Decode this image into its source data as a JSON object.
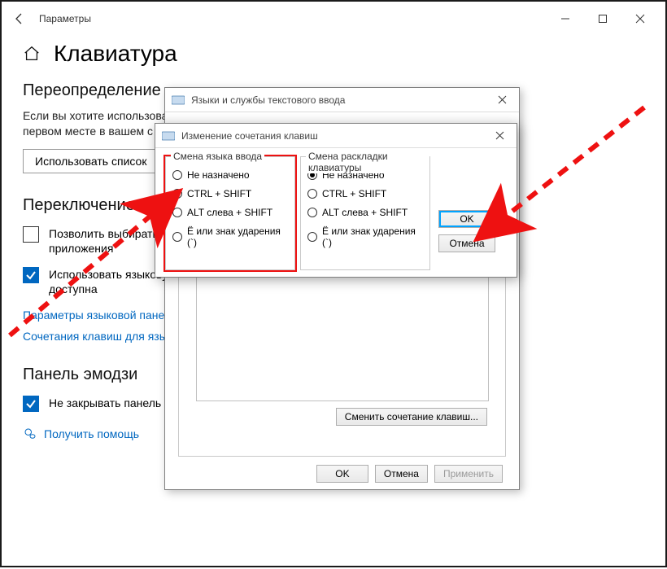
{
  "window": {
    "title": "Параметры",
    "page_title": "Клавиатура"
  },
  "sections": {
    "override": {
      "heading": "Переопределение",
      "text": "Если вы хотите использовать\nпервом месте в вашем с",
      "button": "Использовать список"
    },
    "switching": {
      "heading": "Переключение м",
      "chk1": "Позволить выбирать м\nприложения",
      "chk2": "Использовать языкову\nдоступна",
      "link1": "Параметры языковой пане",
      "link2": "Сочетания клавиш для язы"
    },
    "emoji": {
      "heading": "Панель эмодзи",
      "chk": "Не закрывать панель автоматически после ввода эмодзи"
    },
    "help_link": "Получить помощь"
  },
  "dialog_mid": {
    "title": "Языки и службы текстового ввода",
    "change_btn": "Сменить сочетание клавиш...",
    "ok": "OK",
    "cancel": "Отмена",
    "apply": "Применить"
  },
  "dialog_top": {
    "title": "Изменение сочетания клавиш",
    "group1": {
      "legend": "Смена языка ввода",
      "opt1": "Не назначено",
      "opt2": "CTRL + SHIFT",
      "opt3": "ALT слева + SHIFT",
      "opt4": "Ё или знак ударения (`)"
    },
    "group2": {
      "legend": "Смена раскладки клавиатуры",
      "opt1": "Не назначено",
      "opt2": "CTRL + SHIFT",
      "opt3": "ALT слева + SHIFT",
      "opt4": "Ё или знак ударения (`)"
    },
    "ok": "OK",
    "cancel": "Отмена"
  }
}
